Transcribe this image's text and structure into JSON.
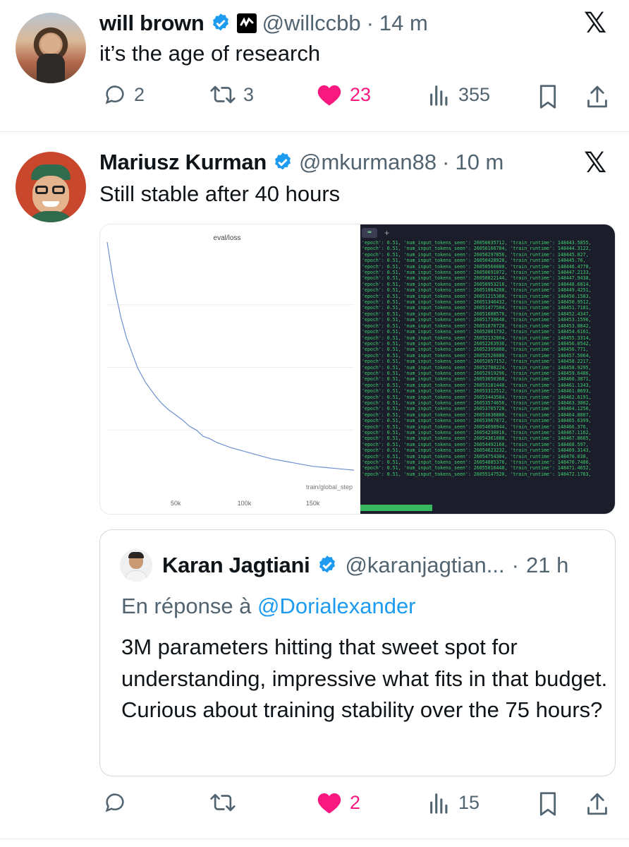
{
  "tweet1": {
    "name": "will brown",
    "handle": "@willccbb",
    "time": "14 m",
    "text": "it’s the age of research",
    "replies": "2",
    "retweets": "3",
    "likes": "23",
    "views": "355"
  },
  "tweet2": {
    "name": "Mariusz Kurman",
    "handle": "@mkurman88",
    "time": "10 m",
    "text": "Still stable after 40 hours",
    "views": "15",
    "likes": "2"
  },
  "chart_data": {
    "type": "line",
    "title": "eval/loss",
    "xlabel": "train/global_step",
    "ylabel": "",
    "x_ticks": [
      "50k",
      "100k",
      "150k"
    ],
    "x": [
      0,
      2000,
      4000,
      6000,
      8000,
      10000,
      12000,
      14000,
      16000,
      18000,
      20000,
      22000,
      25000,
      28000,
      32000,
      36000,
      40000,
      45000,
      50000,
      55000,
      60000,
      65000,
      70000,
      75000,
      80000,
      90000,
      100000,
      110000,
      120000,
      130000,
      140000,
      150000,
      160000,
      170000,
      180000
    ],
    "series": [
      {
        "values": [
          1.0,
          0.93,
          0.86,
          0.8,
          0.75,
          0.7,
          0.66,
          0.62,
          0.59,
          0.56,
          0.53,
          0.5,
          0.47,
          0.44,
          0.41,
          0.38,
          0.355,
          0.33,
          0.31,
          0.29,
          0.265,
          0.25,
          0.225,
          0.215,
          0.2,
          0.18,
          0.165,
          0.15,
          0.135,
          0.125,
          0.115,
          0.105,
          0.1,
          0.095,
          0.09
        ],
        "color": "#6e8fd0"
      }
    ]
  },
  "terminal": {
    "tab": "+",
    "lines": [
      "'epoch': 0.51, 'num_input_tokens_seen': 26050035712, 'train_runtime': 148443.5855,",
      "'epoch': 0.51, 'num_input_tokens_seen': 26050166784, 'train_runtime': 148444.3122,",
      "'epoch': 0.51, 'num_input_tokens_seen': 26050297856, 'train_runtime': 148445.027,",
      "'epoch': 0.51, 'num_input_tokens_seen': 26050428928, 'train_runtime': 148445.76,",
      "'epoch': 0.51, 'num_input_tokens_seen': 26050560000, 'train_runtime': 148446.4778,",
      "'epoch': 0.51, 'num_input_tokens_seen': 26050691072, 'train_runtime': 148447.2133,",
      "'epoch': 0.51, 'num_input_tokens_seen': 26050822144, 'train_runtime': 148447.9438,",
      "'epoch': 0.51, 'num_input_tokens_seen': 26050953216, 'train_runtime': 148448.6814,",
      "'epoch': 0.51, 'num_input_tokens_seen': 26051084288, 'train_runtime': 148449.4251,",
      "'epoch': 0.51, 'num_input_tokens_seen': 26051215360, 'train_runtime': 148450.1583,",
      "'epoch': 0.51, 'num_input_tokens_seen': 26051346432, 'train_runtime': 148450.9512,",
      "'epoch': 0.51, 'num_input_tokens_seen': 26051477504, 'train_runtime': 148451.7181,",
      "'epoch': 0.51, 'num_input_tokens_seen': 26051608576, 'train_runtime': 148452.4347,",
      "'epoch': 0.51, 'num_input_tokens_seen': 26051739648, 'train_runtime': 148453.1596,",
      "'epoch': 0.51, 'num_input_tokens_seen': 26051870720, 'train_runtime': 148453.8842,",
      "'epoch': 0.51, 'num_input_tokens_seen': 26052001792, 'train_runtime': 148454.6161,",
      "'epoch': 0.51, 'num_input_tokens_seen': 26052132864, 'train_runtime': 148455.3314,",
      "'epoch': 0.51, 'num_input_tokens_seen': 26052263936, 'train_runtime': 148456.0542,",
      "'epoch': 0.51, 'num_input_tokens_seen': 26052395008, 'train_runtime': 148456.771,",
      "'epoch': 0.51, 'num_input_tokens_seen': 26052526080, 'train_runtime': 148457.5064,",
      "'epoch': 0.51, 'num_input_tokens_seen': 26052657152, 'train_runtime': 148458.2217,",
      "'epoch': 0.51, 'num_input_tokens_seen': 26052788224, 'train_runtime': 148458.9295,",
      "'epoch': 0.51, 'num_input_tokens_seen': 26052919296, 'train_runtime': 148459.6486,",
      "'epoch': 0.51, 'num_input_tokens_seen': 26053050368, 'train_runtime': 148460.3871,",
      "'epoch': 0.51, 'num_input_tokens_seen': 26053181440, 'train_runtime': 148461.1343,",
      "'epoch': 0.51, 'num_input_tokens_seen': 26053312512, 'train_runtime': 148461.8693,",
      "'epoch': 0.51, 'num_input_tokens_seen': 26053443584, 'train_runtime': 148462.6191,",
      "'epoch': 0.51, 'num_input_tokens_seen': 26053574656, 'train_runtime': 148463.3802,",
      "'epoch': 0.51, 'num_input_tokens_seen': 26053705728, 'train_runtime': 148464.1256,",
      "'epoch': 0.51, 'num_input_tokens_seen': 26053836800, 'train_runtime': 148464.8807,",
      "'epoch': 0.51, 'num_input_tokens_seen': 26053967872, 'train_runtime': 148465.6399,",
      "'epoch': 0.51, 'num_input_tokens_seen': 26054098944, 'train_runtime': 148466.376,",
      "'epoch': 0.51, 'num_input_tokens_seen': 26054230016, 'train_runtime': 148467.1162,",
      "'epoch': 0.51, 'num_input_tokens_seen': 26054361088, 'train_runtime': 148467.8665,",
      "'epoch': 0.51, 'num_input_tokens_seen': 26054492160, 'train_runtime': 148468.597,",
      "'epoch': 0.51, 'num_input_tokens_seen': 26054623232, 'train_runtime': 148469.3143,",
      "'epoch': 0.51, 'num_input_tokens_seen': 26054754304, 'train_runtime': 148470.038,",
      "'epoch': 0.51, 'num_input_tokens_seen': 26054885376, 'train_runtime': 148470.7486,",
      "'epoch': 0.51, 'num_input_tokens_seen': 26055016448, 'train_runtime': 148471.4652,",
      "'epoch': 0.51, 'num_input_tokens_seen': 26055147520, 'train_runtime': 148472.1763,"
    ]
  },
  "quote": {
    "name": "Karan Jagtiani",
    "handle": "@karanjagtian...",
    "time": "21 h",
    "reply_prefix": "En réponse à",
    "reply_to": "@Dorialexander",
    "text": "3M parameters hitting that sweet spot for understanding, impressive what fits in that budget. Curious about training stability over the 75 hours?"
  },
  "colors": {
    "verified": "#1d9bf0",
    "like": "#f91880",
    "gray": "#536471",
    "terminal_bg": "#1b1d2b",
    "terminal_text": "#3ecf6b"
  }
}
